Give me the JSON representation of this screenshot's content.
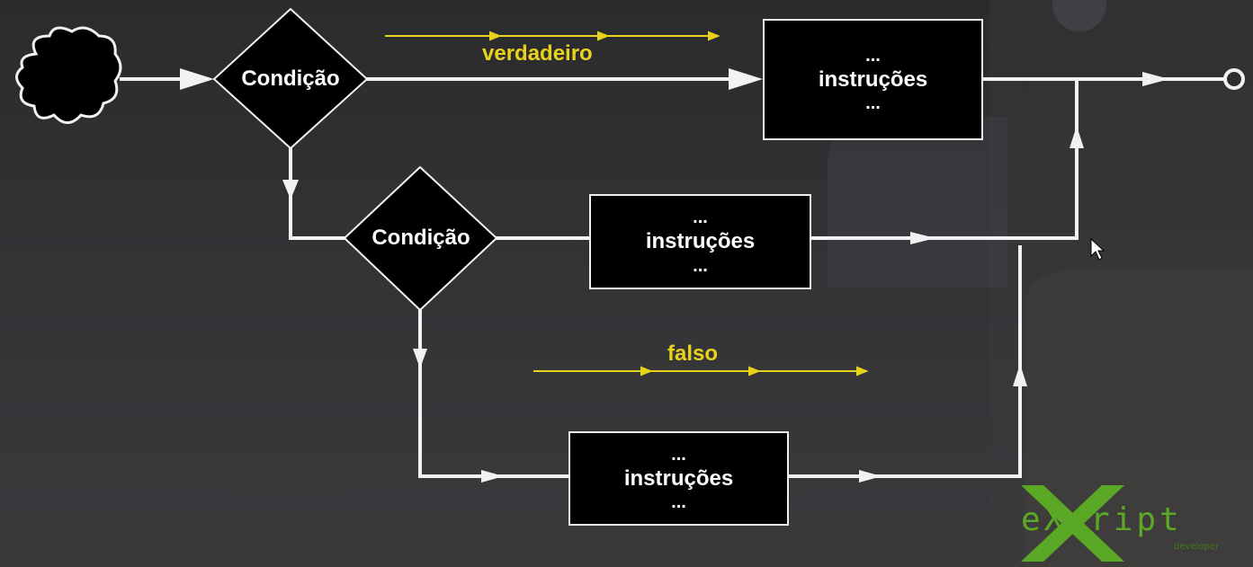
{
  "diagram": {
    "condition_1": "Condição",
    "condition_2": "Condição",
    "block_1": {
      "top": "...",
      "label": "instruções",
      "bottom": "..."
    },
    "block_2": {
      "top": "...",
      "label": "instruções",
      "bottom": "..."
    },
    "block_3": {
      "top": "...",
      "label": "instruções",
      "bottom": "..."
    },
    "true_label": "verdadeiro",
    "false_label": "falso"
  },
  "logo": {
    "wordmark": "eXcript",
    "sub": "developer"
  },
  "colors": {
    "accent_yellow": "#e8d21a",
    "logo_green": "#5aa825",
    "line_white": "#f2f2f2"
  },
  "icons": [
    "cloud-icon",
    "mouse-cursor-icon",
    "end-circle-icon"
  ]
}
